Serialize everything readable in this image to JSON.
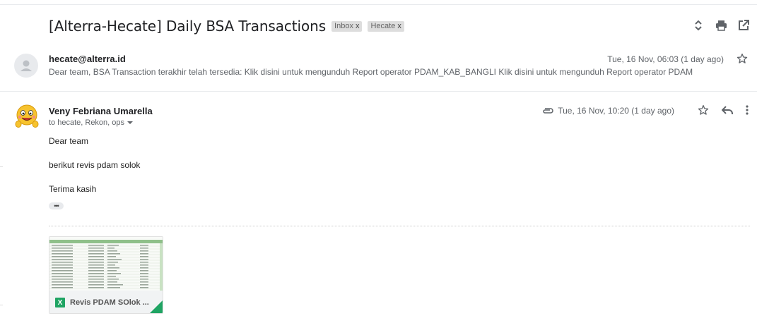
{
  "subject": "[Alterra-Hecate] Daily BSA Transactions",
  "labels": [
    {
      "name": "Inbox",
      "remove": "x"
    },
    {
      "name": "Hecate",
      "remove": "x"
    }
  ],
  "top_icons": [
    "expand-collapse-icon",
    "print-icon",
    "open-in-new-window-icon"
  ],
  "message1": {
    "sender": "hecate@alterra.id",
    "snippet": "Dear team, BSA Transaction terakhir telah tersedia: Klik disini untuk mengunduh Report operator PDAM_KAB_BANGLI Klik disini untuk mengunduh Report operator PDAM",
    "date": "Tue, 16 Nov, 06:03 (1 day ago)"
  },
  "message2": {
    "sender": "Veny Febriana Umarella",
    "recipients": "to hecate, Rekon, ops",
    "date": "Tue, 16 Nov, 10:20 (1 day ago)",
    "body": [
      "Dear team",
      "berikut revis pdam solok",
      "Terima kasih"
    ],
    "ellipsis": "•••",
    "attachment": {
      "icon_letter": "X",
      "name": "Revis PDAM SOlok ..."
    }
  },
  "colors": {
    "excel_green": "#1fa463",
    "label_bg": "#dddddd",
    "muted_text": "#5f6368"
  }
}
